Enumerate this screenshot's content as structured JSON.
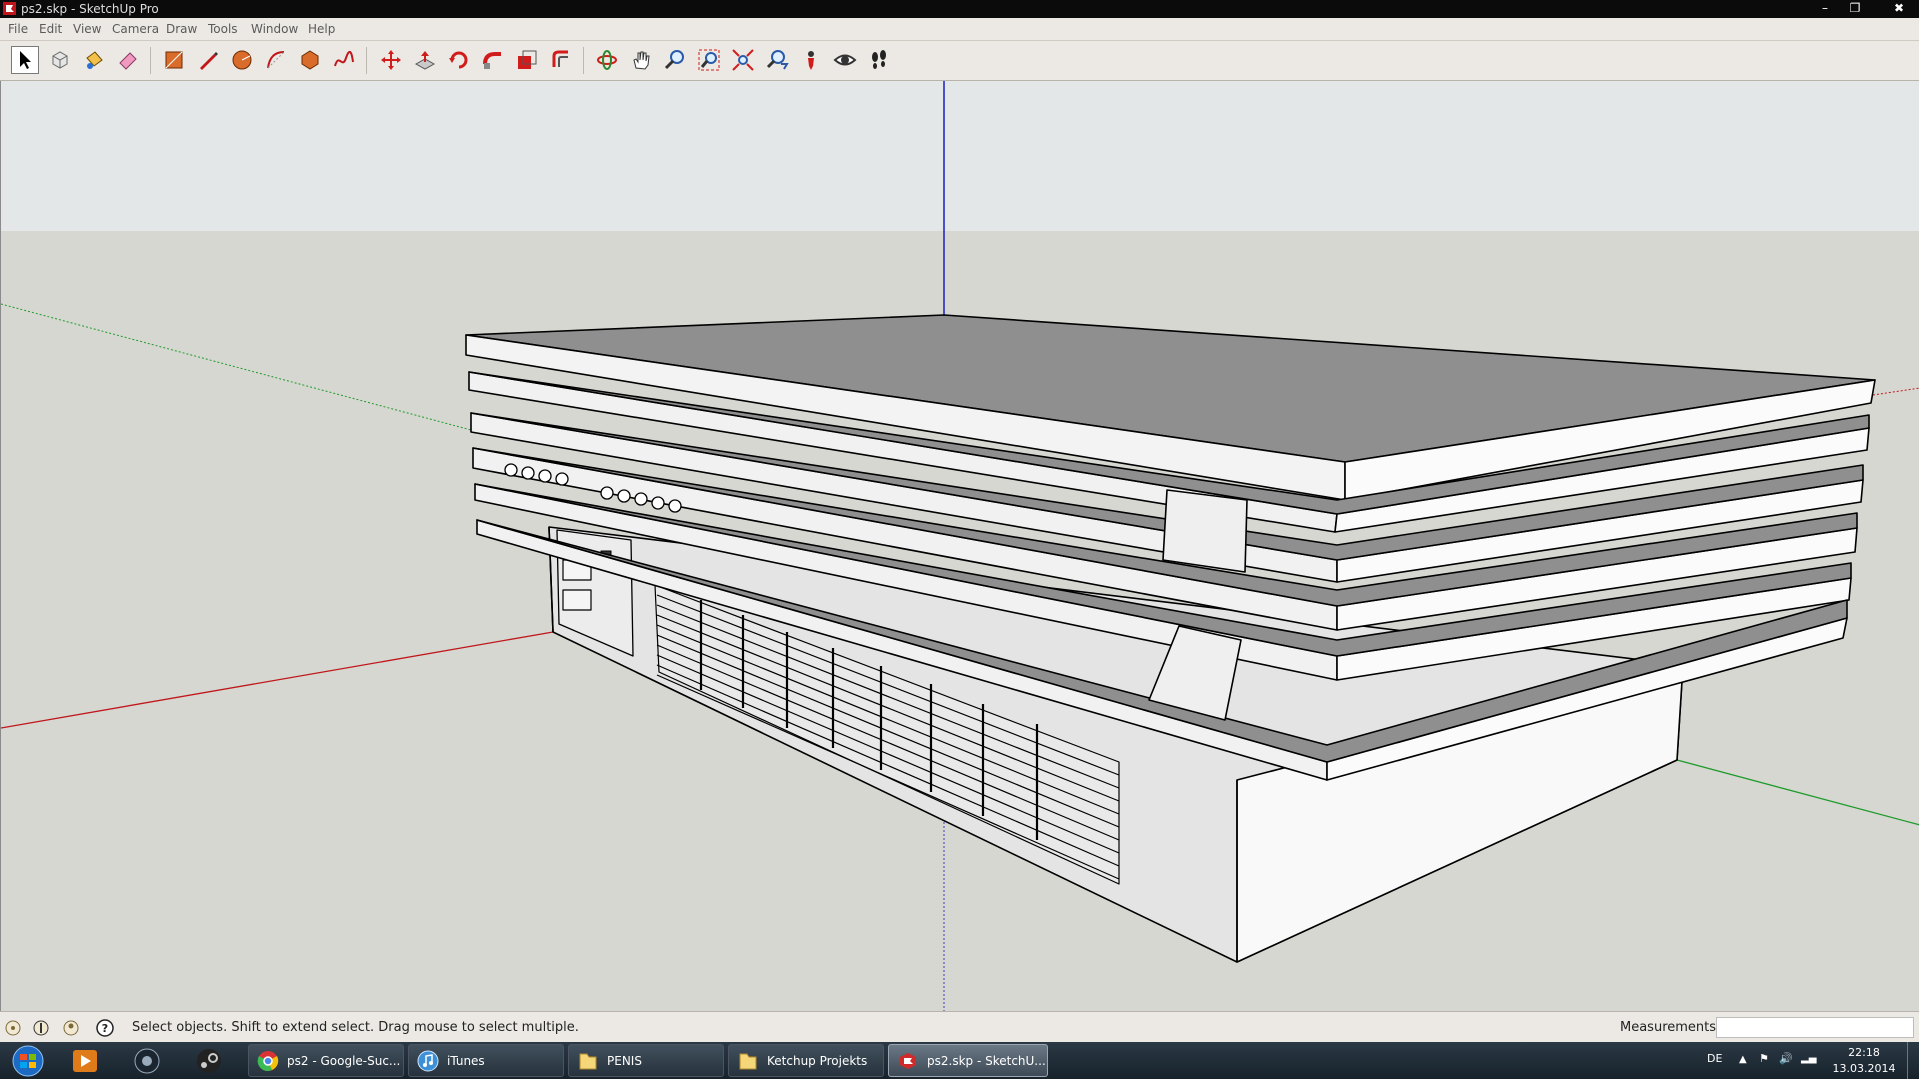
{
  "window": {
    "title": "ps2.skp - SketchUp Pro"
  },
  "menu": [
    "File",
    "Edit",
    "View",
    "Camera",
    "Draw",
    "Tools",
    "Window",
    "Help"
  ],
  "toolbar": {
    "tools": [
      {
        "name": "select-tool",
        "icon": "arrow-icon"
      },
      {
        "name": "make-component-tool",
        "icon": "component-icon"
      },
      {
        "name": "paint-bucket-tool",
        "icon": "paint-bucket-icon"
      },
      {
        "name": "eraser-tool",
        "icon": "eraser-icon"
      },
      {
        "name": "rectangle-tool",
        "icon": "rectangle-icon"
      },
      {
        "name": "line-tool",
        "icon": "pencil-icon"
      },
      {
        "name": "circle-tool",
        "icon": "circle-icon"
      },
      {
        "name": "arc-tool",
        "icon": "arc-icon"
      },
      {
        "name": "polygon-tool",
        "icon": "polygon-icon"
      },
      {
        "name": "freehand-tool",
        "icon": "freehand-icon"
      },
      {
        "name": "move-tool",
        "icon": "move-icon"
      },
      {
        "name": "push-pull-tool",
        "icon": "push-pull-icon"
      },
      {
        "name": "rotate-tool",
        "icon": "rotate-icon"
      },
      {
        "name": "follow-me-tool",
        "icon": "follow-me-icon"
      },
      {
        "name": "scale-tool",
        "icon": "scale-icon"
      },
      {
        "name": "offset-tool",
        "icon": "offset-icon"
      },
      {
        "name": "orbit-tool",
        "icon": "orbit-icon"
      },
      {
        "name": "pan-tool",
        "icon": "hand-icon"
      },
      {
        "name": "zoom-tool",
        "icon": "magnifier-icon"
      },
      {
        "name": "zoom-window-tool",
        "icon": "zoom-window-icon"
      },
      {
        "name": "zoom-extents-tool",
        "icon": "zoom-extents-icon"
      },
      {
        "name": "previous-view-tool",
        "icon": "previous-view-icon"
      },
      {
        "name": "position-camera-tool",
        "icon": "position-camera-icon"
      },
      {
        "name": "look-around-tool",
        "icon": "eye-icon"
      },
      {
        "name": "walk-tool",
        "icon": "footprints-icon"
      }
    ]
  },
  "status": {
    "text": "Select objects. Shift to extend select. Drag mouse to select multiple.",
    "measurements_label": "Measurements",
    "measurements_value": ""
  },
  "taskbar": {
    "tasks": [
      {
        "label": "ps2 - Google-Suc...",
        "icon": "chrome-icon"
      },
      {
        "label": "iTunes",
        "icon": "itunes-icon"
      },
      {
        "label": "PENIS",
        "icon": "folder-icon"
      },
      {
        "label": "Ketchup Projekts",
        "icon": "folder-icon"
      },
      {
        "label": "ps2.skp - SketchU...",
        "icon": "sketchup-icon"
      }
    ],
    "language": "DE",
    "time": "22:18",
    "date": "13.03.2014"
  },
  "colors": {
    "sky": "#e3e7e8",
    "ground": "#d7d7d2",
    "axis_red": "#c0171a",
    "axis_green": "#1e9b2a",
    "axis_blue": "#1d1dc4",
    "top_face": "#8f8f8f"
  }
}
